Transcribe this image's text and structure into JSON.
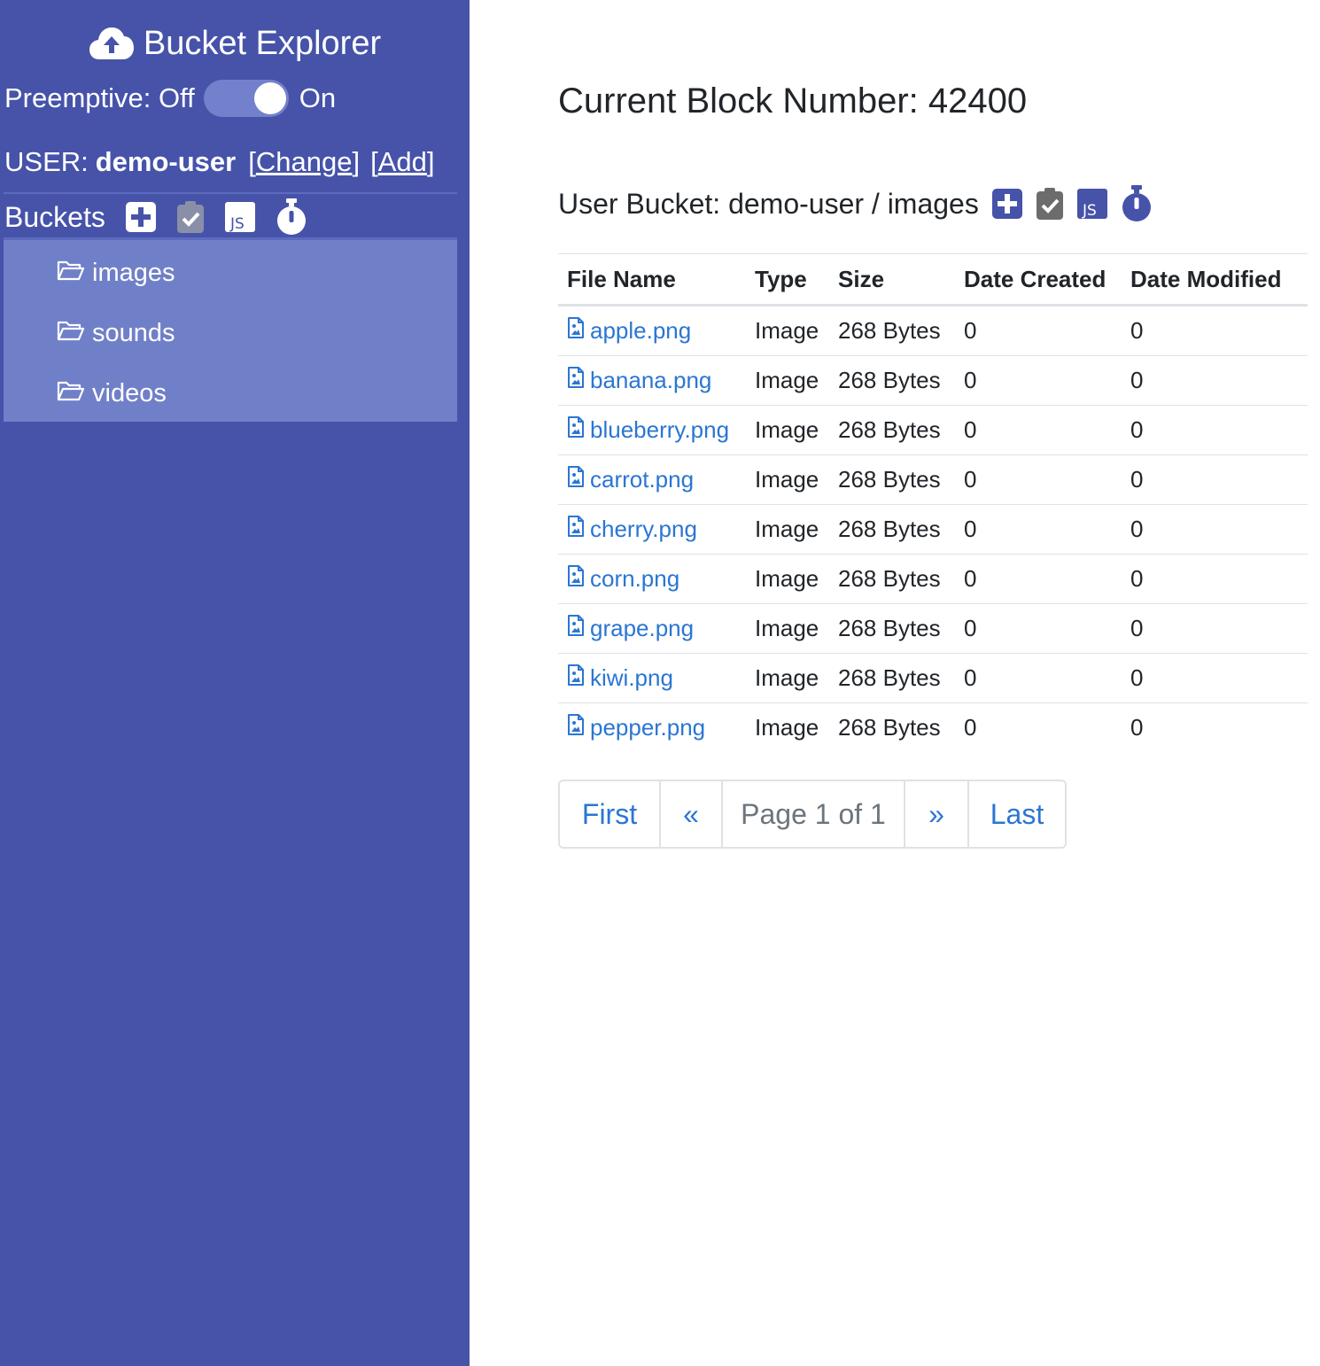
{
  "app": {
    "title": "Bucket Explorer",
    "brand_icon": "cloud-upload-icon"
  },
  "sidebar": {
    "preemptive_label": "Preemptive: Off",
    "preemptive_on_label": "On",
    "preemptive_enabled": true,
    "user_prefix": "USER:",
    "username": "demo-user",
    "change_label": "Change",
    "add_label": "Add",
    "buckets_label": "Buckets",
    "bucket_icons": [
      "plus-square-icon",
      "clipboard-check-icon",
      "js-icon",
      "stopwatch-icon"
    ],
    "buckets": [
      {
        "name": "images",
        "icon": "folder-open-icon"
      },
      {
        "name": "sounds",
        "icon": "folder-open-icon"
      },
      {
        "name": "videos",
        "icon": "folder-open-icon"
      }
    ]
  },
  "main": {
    "block_title": "Current Block Number: 42400",
    "bucket_heading": "User Bucket: demo-user / images",
    "table": {
      "headers": [
        "File Name",
        "Type",
        "Size",
        "Date Created",
        "Date Modified"
      ],
      "rows": [
        {
          "name": "apple.png",
          "type": "Image",
          "size": "268 Bytes",
          "created": "0",
          "modified": "0"
        },
        {
          "name": "banana.png",
          "type": "Image",
          "size": "268 Bytes",
          "created": "0",
          "modified": "0"
        },
        {
          "name": "blueberry.png",
          "type": "Image",
          "size": "268 Bytes",
          "created": "0",
          "modified": "0"
        },
        {
          "name": "carrot.png",
          "type": "Image",
          "size": "268 Bytes",
          "created": "0",
          "modified": "0"
        },
        {
          "name": "cherry.png",
          "type": "Image",
          "size": "268 Bytes",
          "created": "0",
          "modified": "0"
        },
        {
          "name": "corn.png",
          "type": "Image",
          "size": "268 Bytes",
          "created": "0",
          "modified": "0"
        },
        {
          "name": "grape.png",
          "type": "Image",
          "size": "268 Bytes",
          "created": "0",
          "modified": "0"
        },
        {
          "name": "kiwi.png",
          "type": "Image",
          "size": "268 Bytes",
          "created": "0",
          "modified": "0"
        },
        {
          "name": "pepper.png",
          "type": "Image",
          "size": "268 Bytes",
          "created": "0",
          "modified": "0"
        }
      ]
    },
    "pagination": {
      "first": "First",
      "prev": "«",
      "info": "Page 1 of 1",
      "next": "»",
      "last": "Last"
    }
  },
  "colors": {
    "sidebar_bg": "#4653a9",
    "bucket_list_bg": "#7080c8",
    "link": "#2a76d2",
    "icon_accent": "#4653a9"
  }
}
